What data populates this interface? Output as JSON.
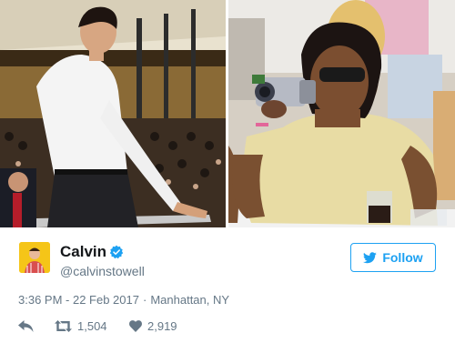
{
  "tweet": {
    "user": {
      "display_name": "Calvin",
      "screen_name": "@calvinstowell",
      "verified": true
    },
    "follow_label": "Follow",
    "timestamp": "3:36 PM - 22 Feb 2017",
    "separator": "·",
    "location": "Manhattan, NY",
    "retweet_count": "1,504",
    "like_count": "2,919"
  },
  "colors": {
    "accent": "#1da1f2",
    "muted_text": "#657786",
    "primary_text": "#14171a",
    "avatar_bg": "#f5c518"
  },
  "icons": {
    "reply": "reply-icon",
    "retweet": "retweet-icon",
    "like": "heart-icon",
    "verified": "verified-badge-icon",
    "follow": "twitter-bird-icon"
  }
}
